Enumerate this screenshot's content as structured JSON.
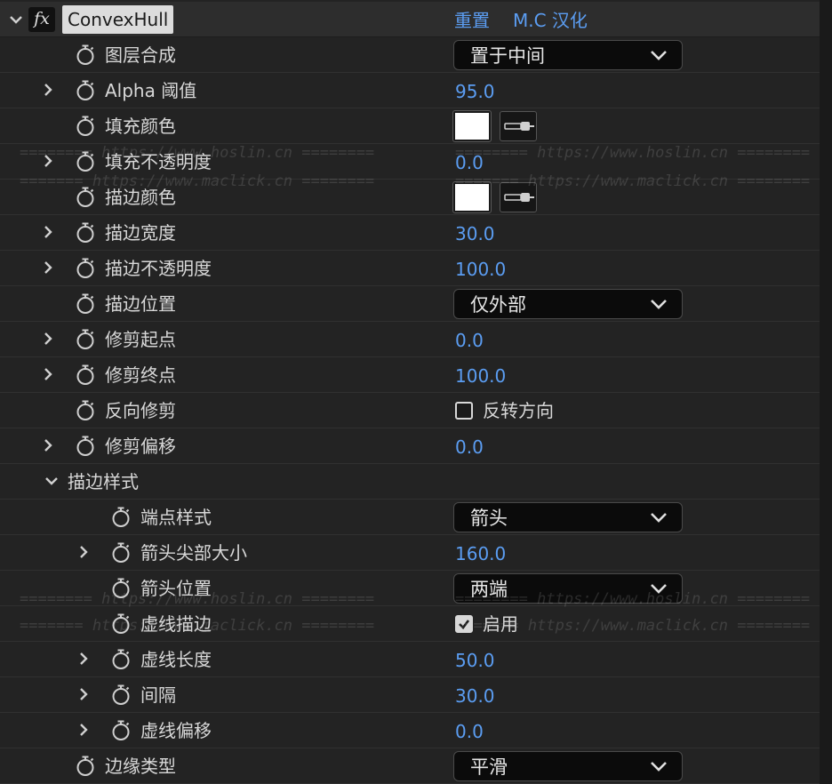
{
  "effect": {
    "fx_symbol": "fx",
    "name": "ConvexHull",
    "reset_label": "重置",
    "about_label": "M.C 汉化"
  },
  "params": {
    "layer_composite": {
      "label": "图层合成",
      "value": "置于中间"
    },
    "alpha_threshold": {
      "label": "Alpha 阈值",
      "value": "95.0"
    },
    "fill_color": {
      "label": "填充颜色",
      "value": "#ffffff"
    },
    "fill_opacity": {
      "label": "填充不透明度",
      "value": "0.0"
    },
    "stroke_color": {
      "label": "描边颜色",
      "value": "#ffffff"
    },
    "stroke_width": {
      "label": "描边宽度",
      "value": "30.0"
    },
    "stroke_opacity": {
      "label": "描边不透明度",
      "value": "100.0"
    },
    "stroke_position": {
      "label": "描边位置",
      "value": "仅外部"
    },
    "trim_start": {
      "label": "修剪起点",
      "value": "0.0"
    },
    "trim_end": {
      "label": "修剪终点",
      "value": "100.0"
    },
    "reverse_trim": {
      "label": "反向修剪",
      "checkbox_label": "反转方向",
      "checked": false
    },
    "trim_offset": {
      "label": "修剪偏移",
      "value": "0.0"
    },
    "stroke_style_group": {
      "label": "描边样式"
    },
    "cap_style": {
      "label": "端点样式",
      "value": "箭头"
    },
    "arrow_head_size": {
      "label": "箭头尖部大小",
      "value": "160.0"
    },
    "arrow_position": {
      "label": "箭头位置",
      "value": "两端"
    },
    "dashed_stroke": {
      "label": "虚线描边",
      "checkbox_label": "启用",
      "checked": true
    },
    "dash_length": {
      "label": "虚线长度",
      "value": "50.0"
    },
    "gap": {
      "label": "间隔",
      "value": "30.0"
    },
    "dash_offset": {
      "label": "虚线偏移",
      "value": "0.0"
    },
    "edge_type": {
      "label": "边缘类型",
      "value": "平滑"
    }
  },
  "watermarks": {
    "hoslin": "======== https://www.hoslin.cn ========",
    "maclick": "======= https://www.maclick.cn ========"
  },
  "colors": {
    "panel_bg": "#232323",
    "value_blue": "#5b9df2",
    "label_text": "#d8d8d8"
  }
}
